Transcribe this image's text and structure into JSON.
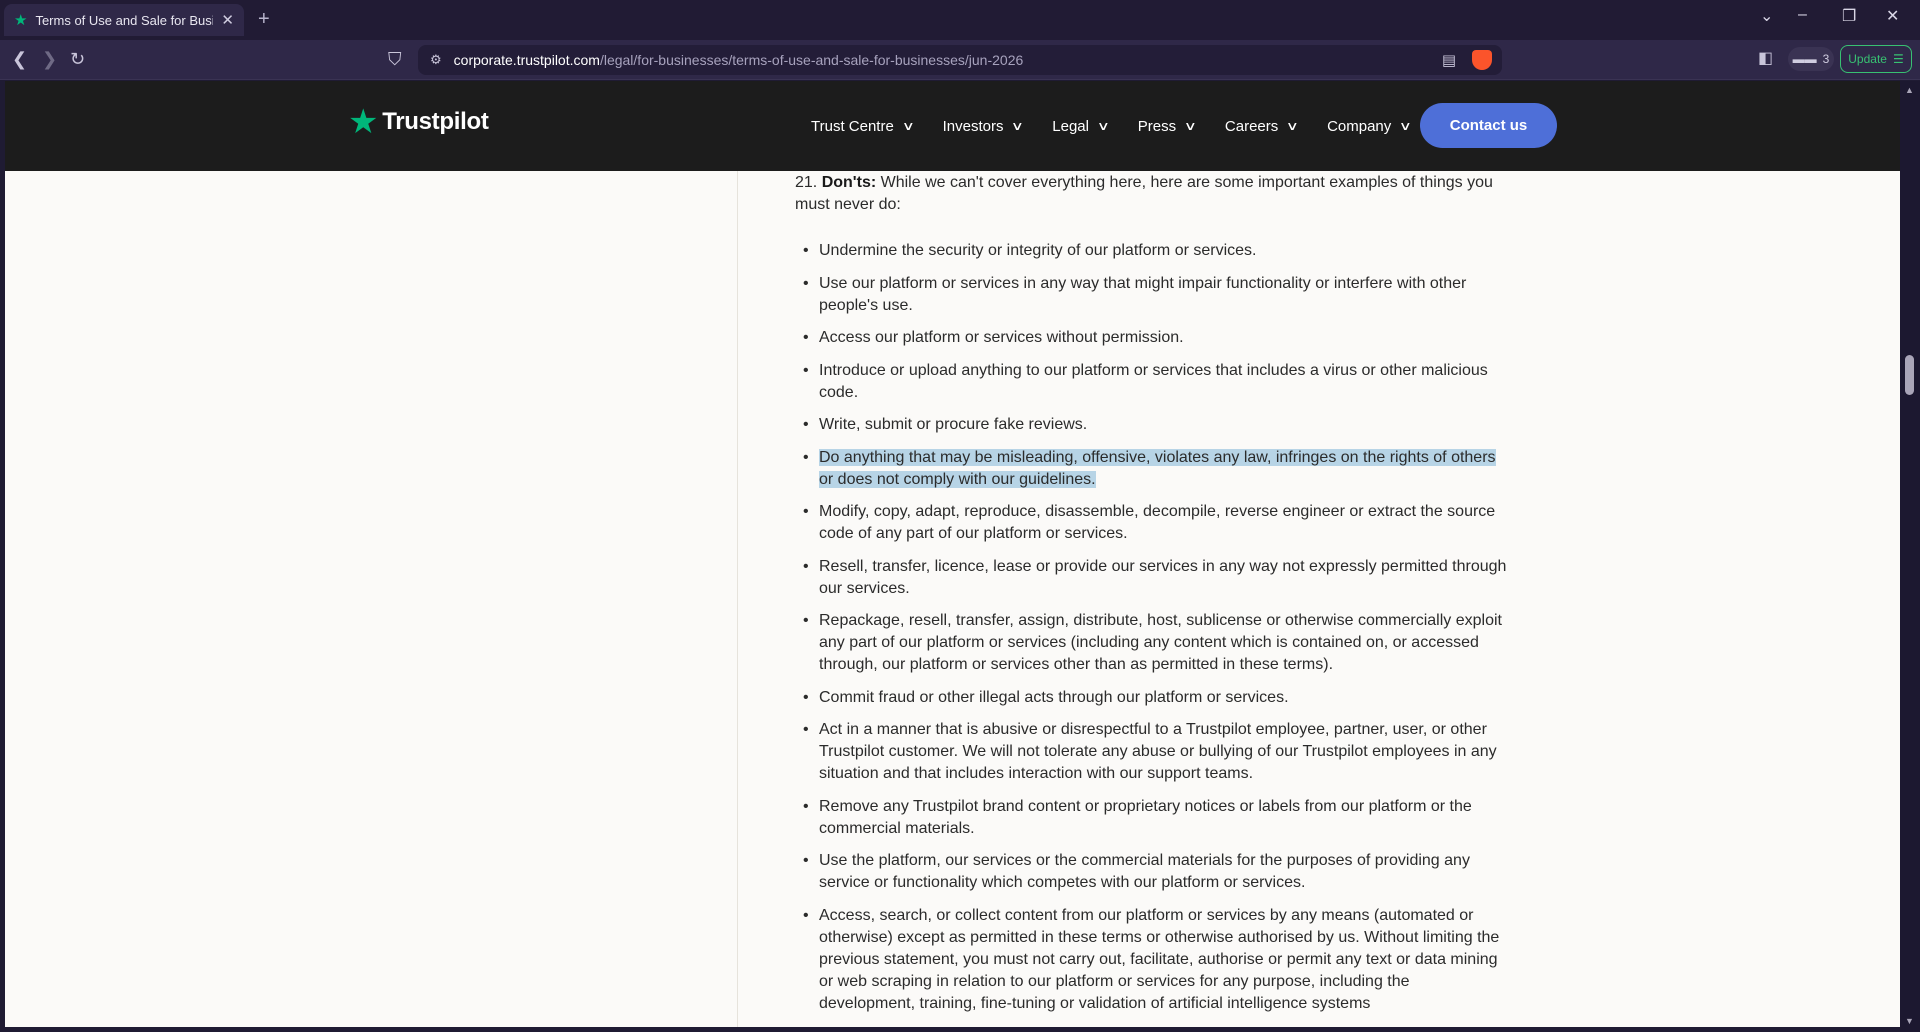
{
  "browser": {
    "tab_title": "Terms of Use and Sale for Businesses",
    "new_tab": "+",
    "url_host": "corporate.trustpilot.com",
    "url_path": "/legal/for-businesses/terms-of-use-and-sale-for-businesses/jun-2026",
    "extensions_count": "3",
    "update_label": "Update"
  },
  "site": {
    "logo_text": "Trustpilot",
    "nav": [
      {
        "label": "Trust Centre"
      },
      {
        "label": "Investors"
      },
      {
        "label": "Legal"
      },
      {
        "label": "Press"
      },
      {
        "label": "Careers"
      },
      {
        "label": "Company"
      }
    ],
    "contact_label": "Contact us"
  },
  "content": {
    "section_number": "21.",
    "section_heading": "Don'ts:",
    "section_intro": "While we can't cover everything here, here are some important examples of things you must never do:",
    "items": [
      "Undermine the security or integrity of our platform or services.",
      "Use our platform or services in any way that might impair functionality or interfere with other people's use.",
      "Access our platform or services without permission.",
      "Introduce or upload anything to our platform or services that includes a virus or other malicious code.",
      "Write, submit or procure fake reviews.",
      "Do anything that may be misleading, offensive, violates any law, infringes on the rights of others or does not comply with our guidelines.",
      "Modify, copy, adapt, reproduce, disassemble, decompile, reverse engineer or extract the source code of any part of our platform or services.",
      "Resell, transfer, licence, lease or provide our services in any way not expressly permitted through our services.",
      "Repackage, resell, transfer, assign, distribute, host, sublicense or otherwise commercially exploit any part of our platform or services (including any content which is contained on, or accessed through, our platform or services other than as permitted in these terms).",
      "Commit fraud or other illegal acts through our platform or services.",
      "Act in a manner that is abusive or disrespectful to a Trustpilot employee, partner, user, or other Trustpilot customer. We will not tolerate any abuse or bullying of our Trustpilot employees in any situation and that includes interaction with our support teams.",
      "Remove any Trustpilot brand content or proprietary notices or labels from our platform or the commercial materials.",
      "Use the platform, our services or the commercial materials for the purposes of providing any service or functionality which competes with our platform or services.",
      "Access, search, or collect content from our platform or services by any means (automated or otherwise) except as permitted in these terms or otherwise authorised by us. Without limiting the previous statement, you must not carry out, facilitate, authorise or permit any text or data mining or web scraping in relation to our platform or services for any purpose, including the development, training, fine-tuning or validation of artificial intelligence systems"
    ],
    "highlighted_item_index": 5
  },
  "colors": {
    "brand_green": "#00b67a",
    "contact_blue": "#4e6fd8",
    "selection": "#b7d4e6",
    "header_bg": "#1c1c1c"
  }
}
